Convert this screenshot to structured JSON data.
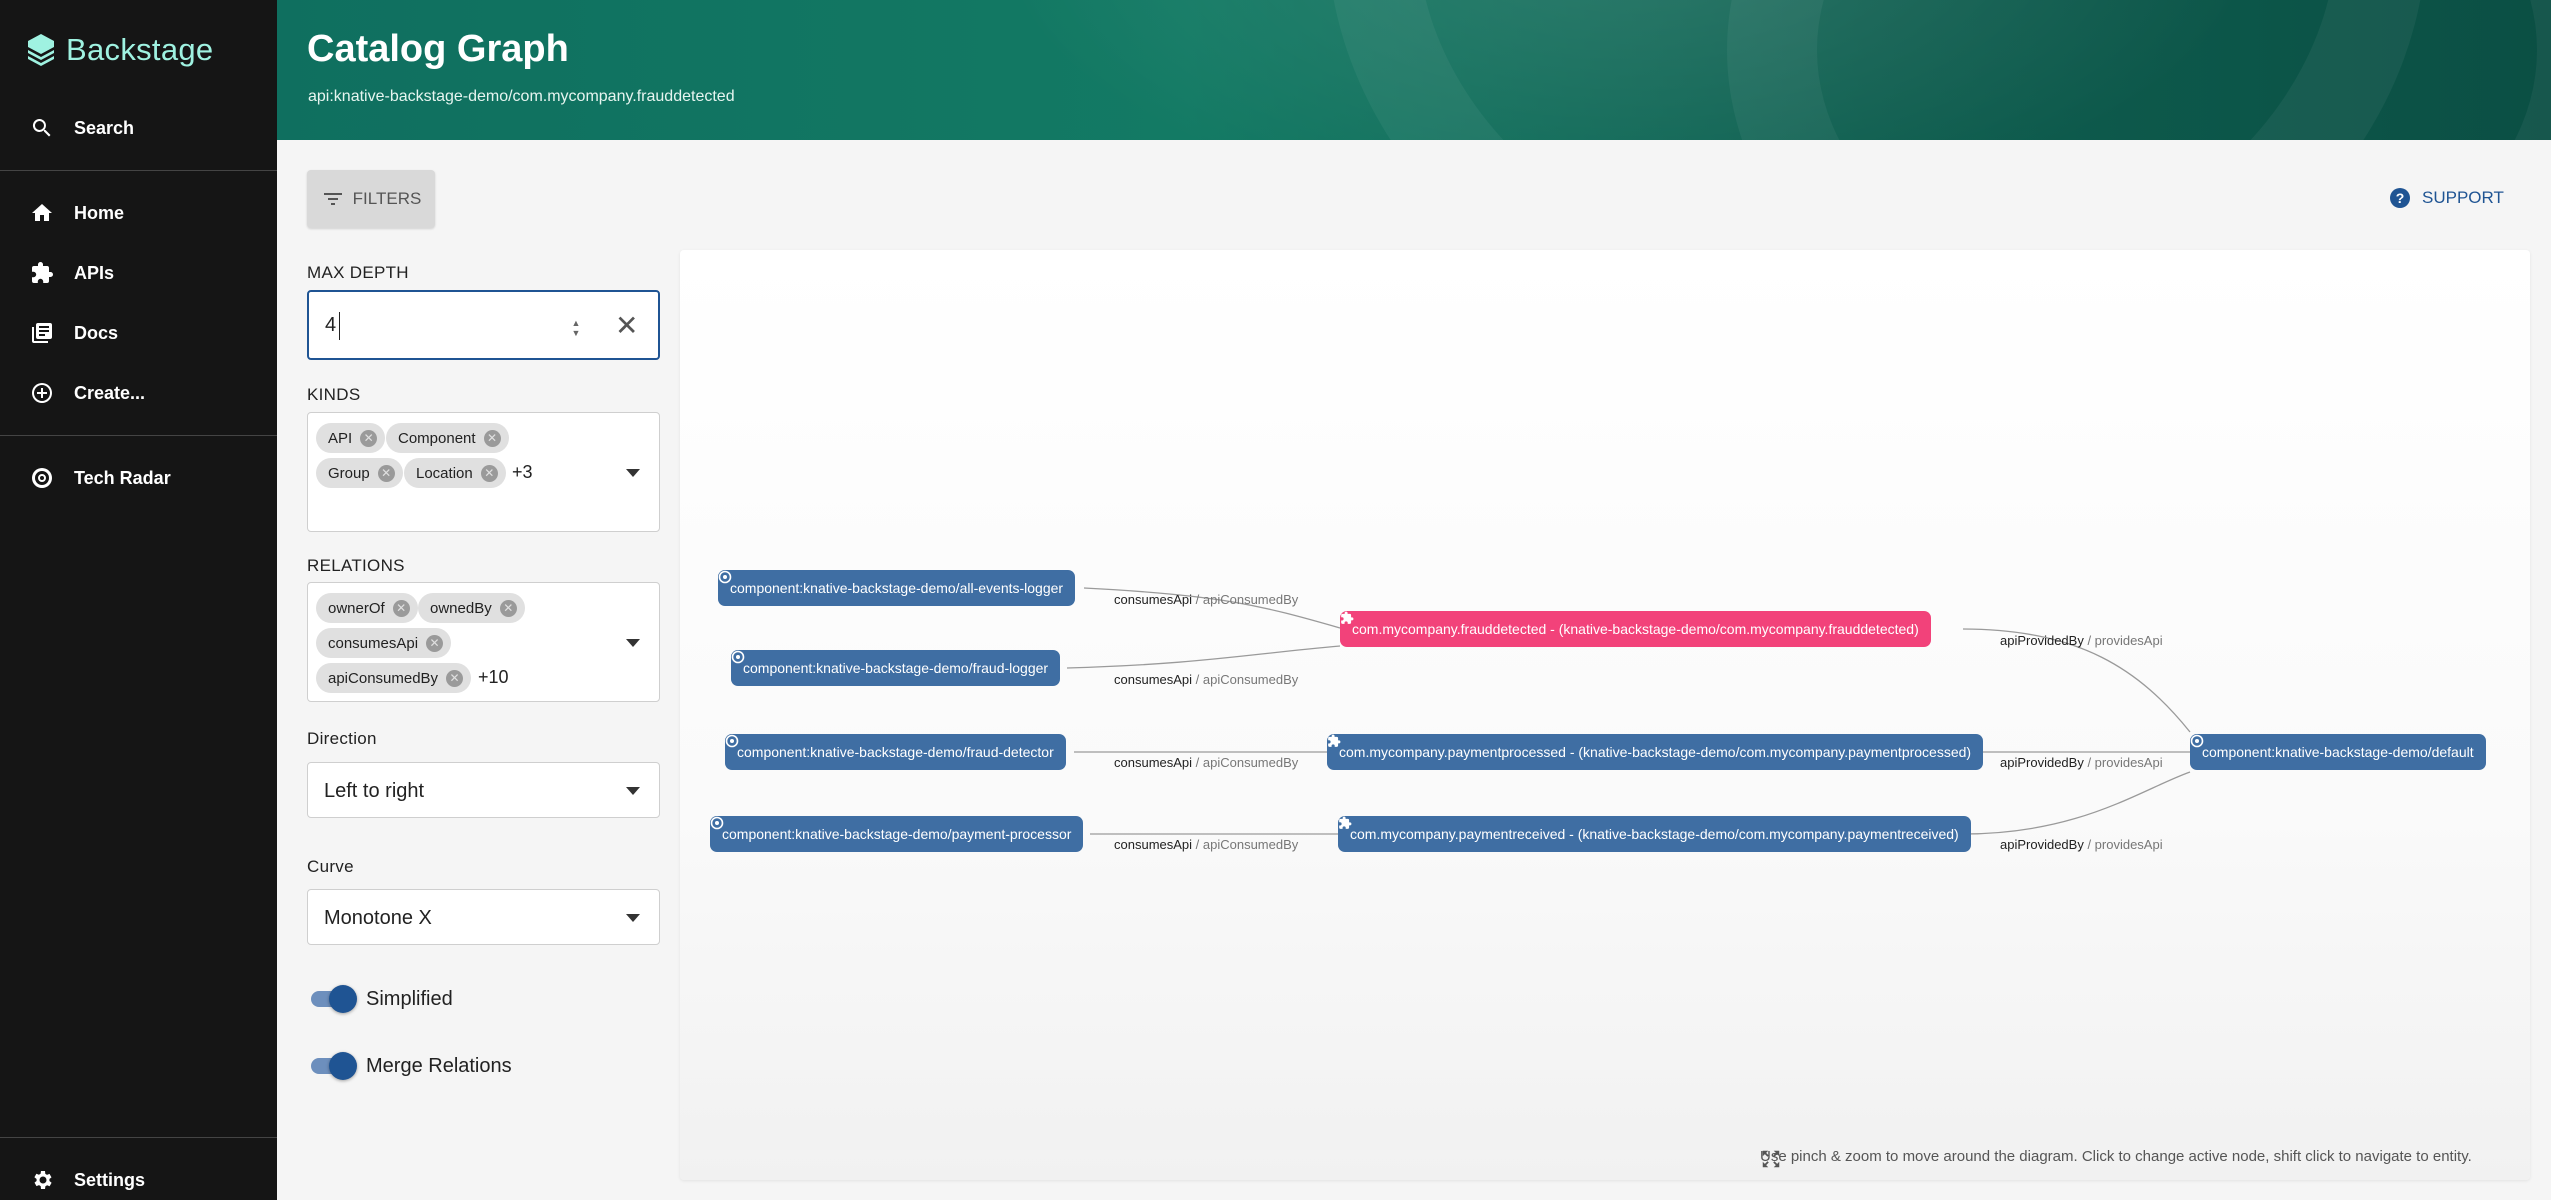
{
  "app": {
    "name": "Backstage"
  },
  "sidebar": {
    "search_label": "Search",
    "items": [
      {
        "label": "Home",
        "icon": "home-icon"
      },
      {
        "label": "APIs",
        "icon": "puzzle-icon"
      },
      {
        "label": "Docs",
        "icon": "library-icon"
      },
      {
        "label": "Create...",
        "icon": "add-circle-icon"
      },
      {
        "label": "Tech Radar",
        "icon": "radar-icon"
      }
    ],
    "settings_label": "Settings"
  },
  "header": {
    "title": "Catalog Graph",
    "subtitle": "api:knative-backstage-demo/com.mycompany.frauddetected"
  },
  "toolbar": {
    "filters_label": "FILTERS",
    "support_label": "SUPPORT"
  },
  "filters": {
    "max_depth": {
      "label": "MAX DEPTH",
      "value": "4"
    },
    "kinds": {
      "label": "KINDS",
      "chips": [
        "API",
        "Component",
        "Group",
        "Location"
      ],
      "more": "+3"
    },
    "relations": {
      "label": "RELATIONS",
      "chips": [
        "ownerOf",
        "ownedBy",
        "consumesApi",
        "apiConsumedBy"
      ],
      "more": "+10"
    },
    "direction": {
      "label": "Direction",
      "value": "Left to right"
    },
    "curve": {
      "label": "Curve",
      "value": "Monotone X"
    },
    "simplified": {
      "label": "Simplified",
      "on": true
    },
    "merge_relations": {
      "label": "Merge Relations",
      "on": true
    }
  },
  "graph": {
    "nodes": [
      {
        "label": "component:knative-backstage-demo/all-events-logger",
        "kind": "component",
        "active": false
      },
      {
        "label": "component:knative-backstage-demo/fraud-logger",
        "kind": "component",
        "active": false
      },
      {
        "label": "component:knative-backstage-demo/fraud-detector",
        "kind": "component",
        "active": false
      },
      {
        "label": "component:knative-backstage-demo/payment-processor",
        "kind": "component",
        "active": false
      },
      {
        "label": "com.mycompany.frauddetected - (knative-backstage-demo/com.mycompany.frauddetected)",
        "kind": "api",
        "active": true
      },
      {
        "label": "com.mycompany.paymentprocessed - (knative-backstage-demo/com.mycompany.paymentprocessed)",
        "kind": "api",
        "active": false
      },
      {
        "label": "com.mycompany.paymentreceived - (knative-backstage-demo/com.mycompany.paymentreceived)",
        "kind": "api",
        "active": false
      },
      {
        "label": "component:knative-backstage-demo/default",
        "kind": "component",
        "active": false
      }
    ],
    "edge_labels": [
      {
        "primary": "consumesApi",
        "secondary": " / apiConsumedBy"
      },
      {
        "primary": "consumesApi",
        "secondary": " / apiConsumedBy"
      },
      {
        "primary": "consumesApi",
        "secondary": " / apiConsumedBy"
      },
      {
        "primary": "consumesApi",
        "secondary": " / apiConsumedBy"
      },
      {
        "primary": "apiProvidedBy",
        "secondary": " / providesApi"
      },
      {
        "primary": "apiProvidedBy",
        "secondary": " / providesApi"
      },
      {
        "primary": "apiProvidedBy",
        "secondary": " / providesApi"
      }
    ],
    "hint": "Use pinch & zoom to move around the diagram. Click to change active node, shift click to navigate to entity."
  },
  "colors": {
    "accent": "#1f5493",
    "node": "#3f6ea3",
    "active_node": "#f2427a",
    "header": "#137a64",
    "logo": "#9ff2e1"
  }
}
